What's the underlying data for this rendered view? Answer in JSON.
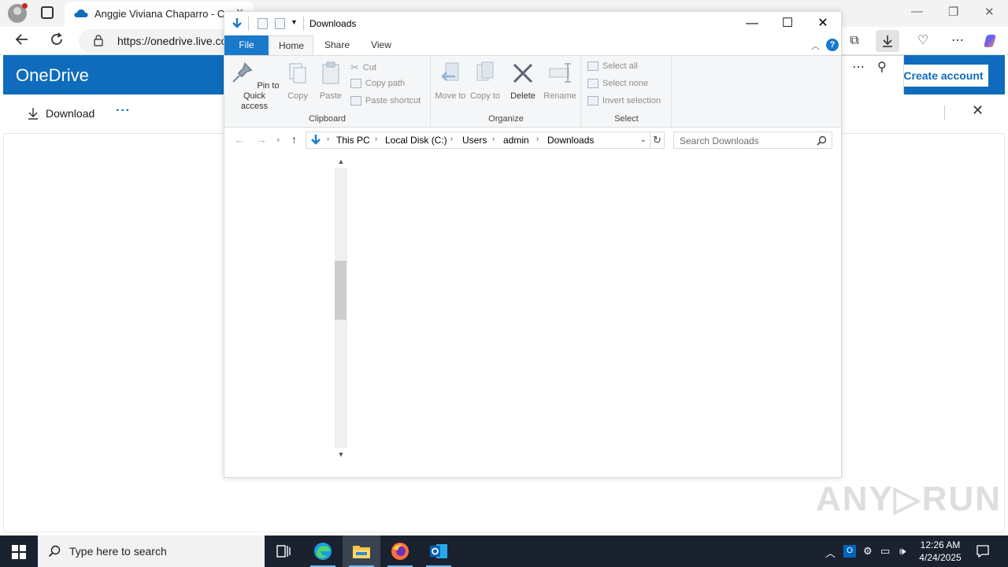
{
  "browser": {
    "tab_title": "Anggie Viviana Chaparro - OneDrive",
    "tab_close": "✕",
    "url": "https://onedrive.live.com",
    "back_icon": "arrow-left-icon",
    "refresh_icon": "refresh-icon",
    "more": "⋯"
  },
  "onedrive": {
    "brand": "OneDrive",
    "create_account": "Create account",
    "download_label": "Download",
    "more": "···",
    "accent": "#0f6cbd"
  },
  "explorer": {
    "title": "Downloads",
    "tabs": {
      "file": "File",
      "home": "Home",
      "share": "Share",
      "view": "View"
    },
    "help": "?",
    "clipboard": {
      "label": "Clipboard",
      "pin": "Pin to Quick access",
      "copy": "Copy",
      "paste": "Paste",
      "cut": "Cut",
      "copy_path": "Copy path",
      "paste_shortcut": "Paste shortcut"
    },
    "organize": {
      "label": "Organize",
      "move_to": "Move to",
      "copy_to": "Copy to",
      "delete": "Delete",
      "rename": "Rename"
    },
    "select": {
      "label": "Select",
      "select_all": "Select all",
      "select_none": "Select none",
      "invert": "Invert selection"
    },
    "breadcrumb": [
      "This PC",
      "Local Disk (C:)",
      "Users",
      "admin",
      "Downloads"
    ],
    "search_placeholder": "Search Downloads",
    "scroll_position": 0.42
  },
  "taskbar": {
    "search_placeholder": "Type here to search",
    "time": "12:26 AM",
    "date": "4/24/2025"
  },
  "watermark": "ANY▷RUN"
}
